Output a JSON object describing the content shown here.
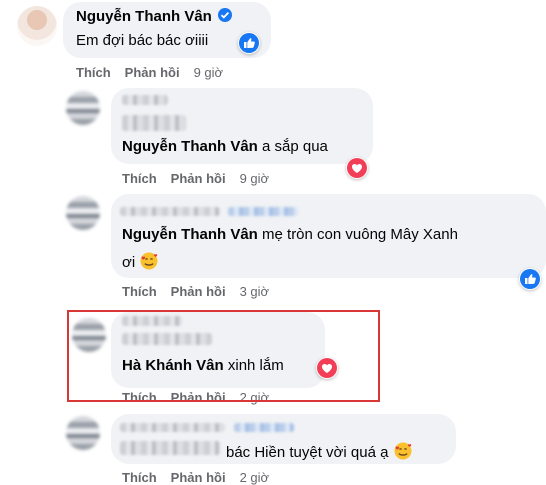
{
  "comments": [
    {
      "author": "Nguyễn Thanh Vân",
      "text": "Em đợi bác bác ơiiii",
      "verified": true,
      "reaction": "like",
      "actions": {
        "like": "Thích",
        "reply": "Phản hồi",
        "time": "9 giờ"
      }
    },
    {
      "author": "Nguyễn Thanh Vân",
      "text": "a sắp qua",
      "reaction": "love",
      "actions": {
        "like": "Thích",
        "reply": "Phản hồi",
        "time": "9 giờ"
      }
    },
    {
      "author": "Nguyễn Thanh Vân",
      "text_line1": "mẹ tròn con vuông Mây Xanh",
      "text_line2": "ơi",
      "emoji": "smiling-face-with-hearts",
      "reaction": "like",
      "actions": {
        "like": "Thích",
        "reply": "Phản hồi",
        "time": "3 giờ"
      }
    },
    {
      "author": "Hà Khánh Vân",
      "text": "xinh lắm",
      "reaction": "love",
      "highlight_color": "#d93636",
      "actions": {
        "like": "Thích",
        "reply": "Phản hồi",
        "time": "2 giờ"
      }
    },
    {
      "text": "bác Hiền tuyệt vời quá ạ",
      "emoji": "smiling-face-with-hearts",
      "actions": {
        "like": "Thích",
        "reply": "Phản hồi",
        "time": "2 giờ"
      }
    }
  ],
  "colors": {
    "like_blue": "#1877f2",
    "love_red": "#f33e58",
    "bubble": "#f0f2f5",
    "meta": "#65676b"
  }
}
